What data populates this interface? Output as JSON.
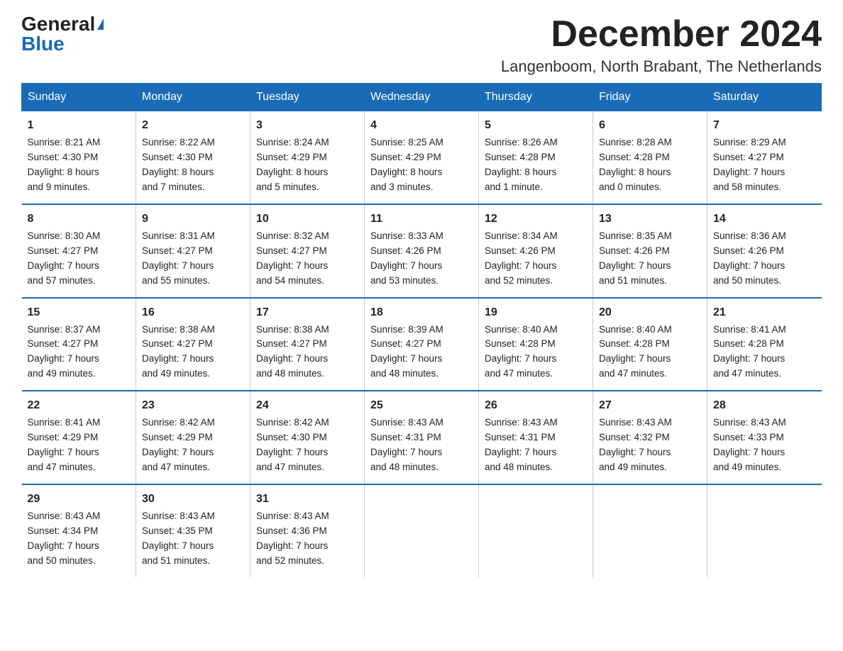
{
  "logo": {
    "general": "General",
    "blue": "Blue"
  },
  "header": {
    "month": "December 2024",
    "location": "Langenboom, North Brabant, The Netherlands"
  },
  "weekdays": [
    "Sunday",
    "Monday",
    "Tuesday",
    "Wednesday",
    "Thursday",
    "Friday",
    "Saturday"
  ],
  "weeks": [
    [
      {
        "day": "1",
        "sunrise": "8:21 AM",
        "sunset": "4:30 PM",
        "daylight": "8 hours and 9 minutes."
      },
      {
        "day": "2",
        "sunrise": "8:22 AM",
        "sunset": "4:30 PM",
        "daylight": "8 hours and 7 minutes."
      },
      {
        "day": "3",
        "sunrise": "8:24 AM",
        "sunset": "4:29 PM",
        "daylight": "8 hours and 5 minutes."
      },
      {
        "day": "4",
        "sunrise": "8:25 AM",
        "sunset": "4:29 PM",
        "daylight": "8 hours and 3 minutes."
      },
      {
        "day": "5",
        "sunrise": "8:26 AM",
        "sunset": "4:28 PM",
        "daylight": "8 hours and 1 minute."
      },
      {
        "day": "6",
        "sunrise": "8:28 AM",
        "sunset": "4:28 PM",
        "daylight": "8 hours and 0 minutes."
      },
      {
        "day": "7",
        "sunrise": "8:29 AM",
        "sunset": "4:27 PM",
        "daylight": "7 hours and 58 minutes."
      }
    ],
    [
      {
        "day": "8",
        "sunrise": "8:30 AM",
        "sunset": "4:27 PM",
        "daylight": "7 hours and 57 minutes."
      },
      {
        "day": "9",
        "sunrise": "8:31 AM",
        "sunset": "4:27 PM",
        "daylight": "7 hours and 55 minutes."
      },
      {
        "day": "10",
        "sunrise": "8:32 AM",
        "sunset": "4:27 PM",
        "daylight": "7 hours and 54 minutes."
      },
      {
        "day": "11",
        "sunrise": "8:33 AM",
        "sunset": "4:26 PM",
        "daylight": "7 hours and 53 minutes."
      },
      {
        "day": "12",
        "sunrise": "8:34 AM",
        "sunset": "4:26 PM",
        "daylight": "7 hours and 52 minutes."
      },
      {
        "day": "13",
        "sunrise": "8:35 AM",
        "sunset": "4:26 PM",
        "daylight": "7 hours and 51 minutes."
      },
      {
        "day": "14",
        "sunrise": "8:36 AM",
        "sunset": "4:26 PM",
        "daylight": "7 hours and 50 minutes."
      }
    ],
    [
      {
        "day": "15",
        "sunrise": "8:37 AM",
        "sunset": "4:27 PM",
        "daylight": "7 hours and 49 minutes."
      },
      {
        "day": "16",
        "sunrise": "8:38 AM",
        "sunset": "4:27 PM",
        "daylight": "7 hours and 49 minutes."
      },
      {
        "day": "17",
        "sunrise": "8:38 AM",
        "sunset": "4:27 PM",
        "daylight": "7 hours and 48 minutes."
      },
      {
        "day": "18",
        "sunrise": "8:39 AM",
        "sunset": "4:27 PM",
        "daylight": "7 hours and 48 minutes."
      },
      {
        "day": "19",
        "sunrise": "8:40 AM",
        "sunset": "4:28 PM",
        "daylight": "7 hours and 47 minutes."
      },
      {
        "day": "20",
        "sunrise": "8:40 AM",
        "sunset": "4:28 PM",
        "daylight": "7 hours and 47 minutes."
      },
      {
        "day": "21",
        "sunrise": "8:41 AM",
        "sunset": "4:28 PM",
        "daylight": "7 hours and 47 minutes."
      }
    ],
    [
      {
        "day": "22",
        "sunrise": "8:41 AM",
        "sunset": "4:29 PM",
        "daylight": "7 hours and 47 minutes."
      },
      {
        "day": "23",
        "sunrise": "8:42 AM",
        "sunset": "4:29 PM",
        "daylight": "7 hours and 47 minutes."
      },
      {
        "day": "24",
        "sunrise": "8:42 AM",
        "sunset": "4:30 PM",
        "daylight": "7 hours and 47 minutes."
      },
      {
        "day": "25",
        "sunrise": "8:43 AM",
        "sunset": "4:31 PM",
        "daylight": "7 hours and 48 minutes."
      },
      {
        "day": "26",
        "sunrise": "8:43 AM",
        "sunset": "4:31 PM",
        "daylight": "7 hours and 48 minutes."
      },
      {
        "day": "27",
        "sunrise": "8:43 AM",
        "sunset": "4:32 PM",
        "daylight": "7 hours and 49 minutes."
      },
      {
        "day": "28",
        "sunrise": "8:43 AM",
        "sunset": "4:33 PM",
        "daylight": "7 hours and 49 minutes."
      }
    ],
    [
      {
        "day": "29",
        "sunrise": "8:43 AM",
        "sunset": "4:34 PM",
        "daylight": "7 hours and 50 minutes."
      },
      {
        "day": "30",
        "sunrise": "8:43 AM",
        "sunset": "4:35 PM",
        "daylight": "7 hours and 51 minutes."
      },
      {
        "day": "31",
        "sunrise": "8:43 AM",
        "sunset": "4:36 PM",
        "daylight": "7 hours and 52 minutes."
      },
      null,
      null,
      null,
      null
    ]
  ],
  "labels": {
    "sunrise": "Sunrise:",
    "sunset": "Sunset:",
    "daylight": "Daylight:"
  }
}
